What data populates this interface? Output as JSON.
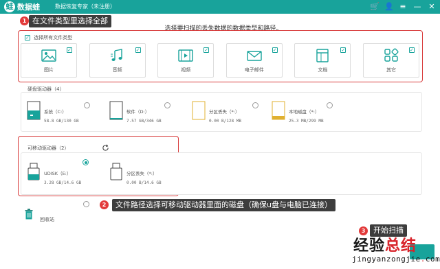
{
  "app": {
    "name": "数据蛙",
    "subtitle": "数据恢复专家（未注册）",
    "logo_glyph": "蛙",
    "brand_color": "#18a39b",
    "titlebar_icons": [
      {
        "name": "cart-icon",
        "glyph": "🛒"
      },
      {
        "name": "user-icon",
        "glyph": "👤"
      },
      {
        "name": "menu-icon",
        "glyph": "≡"
      },
      {
        "name": "minimize-icon",
        "glyph": "—"
      },
      {
        "name": "close-icon",
        "glyph": "✕"
      }
    ]
  },
  "annotations": {
    "step1_num": "1",
    "step1_text": "在文件类型里选择全部",
    "step2_num": "2",
    "step2_text": "文件路径选择可移动驱动器里面的磁盘（确保u盘与电脑已连接）",
    "step3_num": "3",
    "step3_text": "开始扫描",
    "highlight_color": "#d83a3a"
  },
  "heading": "选择要扫描的丢失数据的数据类型和路径。",
  "file_types": {
    "select_all_label": "选择所有文件类型",
    "select_all_checked": true,
    "items": [
      {
        "label": "图片",
        "icon": "image-icon",
        "checked": true
      },
      {
        "label": "音频",
        "icon": "audio-icon",
        "checked": true
      },
      {
        "label": "视频",
        "icon": "video-icon",
        "checked": true
      },
      {
        "label": "电子邮件",
        "icon": "email-icon",
        "checked": true
      },
      {
        "label": "文档",
        "icon": "document-icon",
        "checked": true
      },
      {
        "label": "其它",
        "icon": "other-icon",
        "checked": true
      }
    ]
  },
  "hard_drives": {
    "label": "硬盘驱动器（4）",
    "items": [
      {
        "name": "系统（C:）",
        "size": "58.8 GB/130 GB",
        "used_fraction": 0.45,
        "selected": false
      },
      {
        "name": "软件（D:）",
        "size": "7.57 GB/346 GB",
        "used_fraction": 0.02,
        "selected": false
      },
      {
        "name": "分区丢失（*:）",
        "size": "0.00  B/128 MB",
        "used_fraction": 0.0,
        "selected": false
      },
      {
        "name": "本地磁盘（*:）",
        "size": "25.3 MB/299 MB",
        "used_fraction": 0.08,
        "selected": false
      }
    ]
  },
  "removable_drives": {
    "label": "可移动驱动器（2）",
    "items": [
      {
        "name": "UDISK（E:）",
        "size": "3.28 GB/14.6 GB",
        "used_fraction": 0.22,
        "selected": true
      },
      {
        "name": "分区丢失（*:）",
        "size": "0.00  B/14.6 GB",
        "used_fraction": 0.0,
        "selected": false
      }
    ]
  },
  "recycle_bin": {
    "label": "回收站",
    "selected": false
  },
  "watermark": {
    "big_a": "经验",
    "big_b": "总结",
    "small_a": "jingyanzongjie",
    "small_dot": ".",
    "small_b": "com"
  }
}
